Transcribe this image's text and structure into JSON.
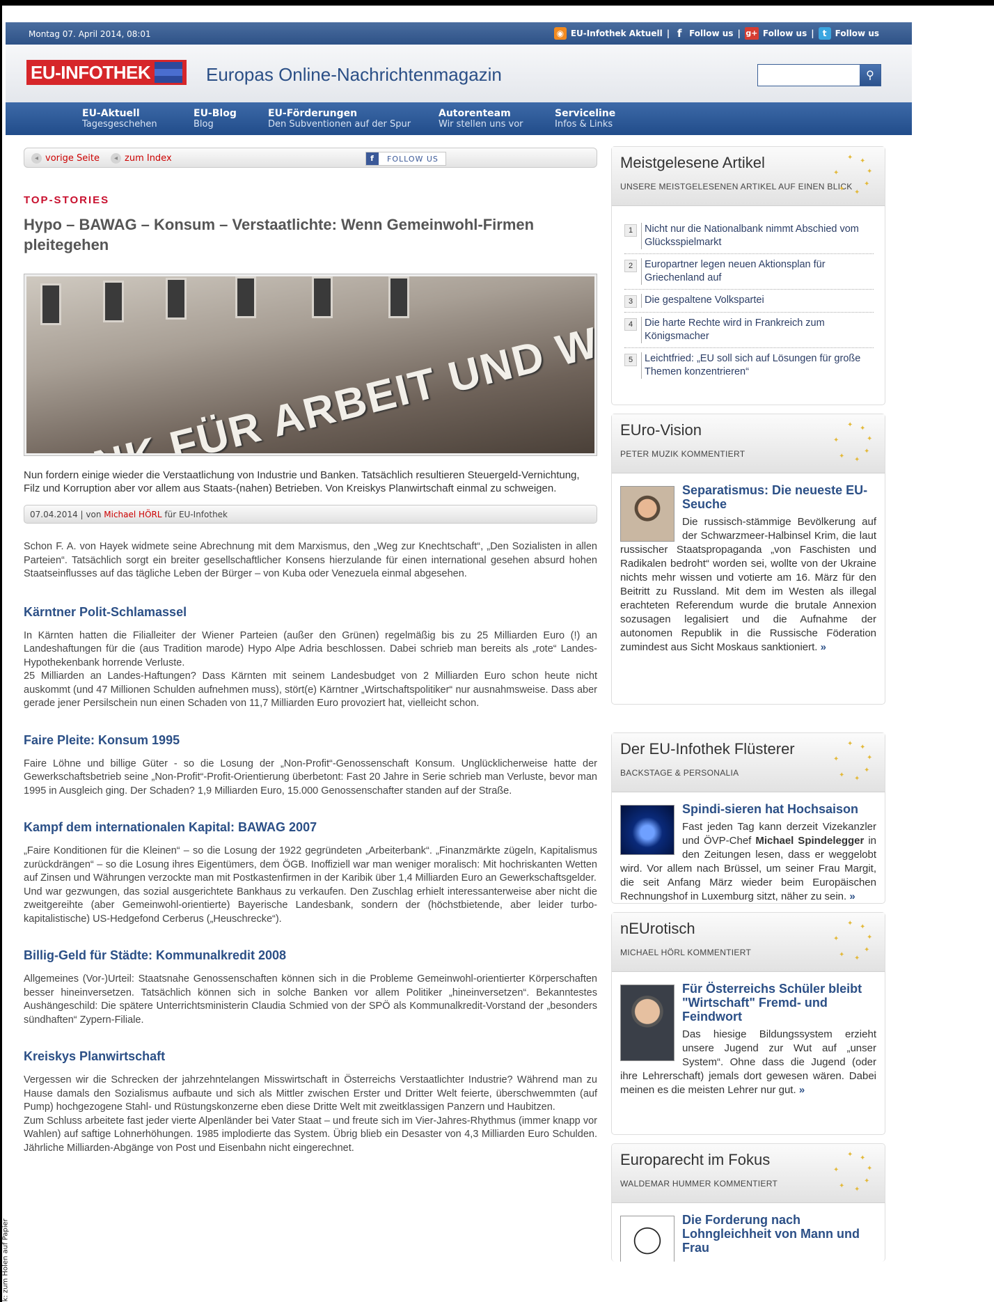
{
  "edge_text": "… grafik: zum Holen auf Papier",
  "topbar": {
    "date": "Montag 07. April 2014, 08:01",
    "aktuell": "EU-Infothek Aktuell",
    "sep": "|",
    "follow1": "Follow us",
    "follow2": "Follow us",
    "follow3": "Follow us"
  },
  "header": {
    "logo": "EU-INFOTHEK",
    "tagline": "Europas Online-Nachrichtenmagazin",
    "search_placeholder": ""
  },
  "nav": [
    {
      "title": "EU-Aktuell",
      "sub": "Tagesgeschehen"
    },
    {
      "title": "EU-Blog",
      "sub": "Blog"
    },
    {
      "title": "EU-Förderungen",
      "sub": "Den Subventionen auf der Spur"
    },
    {
      "title": "Autorenteam",
      "sub": "Wir stellen uns vor"
    },
    {
      "title": "Serviceline",
      "sub": "Infos & Links"
    }
  ],
  "crumbs": {
    "prev": "vorige Seite",
    "index": "zum Index",
    "follow": "FOLLOW US"
  },
  "article": {
    "section": "TOP-STORIES",
    "title": "Hypo – BAWAG – Konsum – Verstaatlichte: Wenn Gemeinwohl-Firmen pleitegehen",
    "image_text": "BANK FÜR ARBEIT UND WIRTSCHAF",
    "lead": "Nun fordern einige wieder die Verstaatlichung von Industrie und Banken. Tatsächlich resultieren Steuergeld-Vernichtung, Filz und Korruption aber vor allem aus Staats-(nahen) Betrieben. Von Kreiskys Planwirtschaft einmal zu schweigen.",
    "meta_date": "07.04.2014 | von",
    "meta_author": "Michael HÖRL",
    "meta_suffix": "für EU-Infothek",
    "intro": "Schon F. A. von Hayek widmete seine Abrechnung mit  dem Marxismus, den  „Weg zur Knechtschaft“, „Den Sozialisten in allen Parteien“. Tatsächlich sorgt ein breiter gesellschaftlicher Konsens hierzulande für einen international gesehen absurd hohen Staatseinflusses auf das tägliche Leben der Bürger – von Kuba oder Venezuela einmal abgesehen.",
    "sections": [
      {
        "heading": "Kärntner Polit-Schlamassel",
        "p1": "In Kärnten hatten die Filialleiter der Wiener Parteien (außer den Grünen) regelmäßig bis zu 25 Milliarden Euro (!) an Landeshaftungen für die (aus Tradition marode) Hypo Alpe Adria beschlossen. Dabei schrieb man bereits als „rote“ Landes-Hypothekenbank horrende Verluste.",
        "p2": "25 Milliarden an Landes-Haftungen? Dass Kärnten mit seinem Landesbudget von 2 Milliarden Euro schon heute nicht auskommt (und 47 Millionen Schulden aufnehmen muss), stört(e)   Kärntner „Wirtschaftspolitiker“ nur ausnahmsweise. Dass aber gerade jener Persilschein nun einen Schaden von 11,7 Milliarden Euro provoziert hat, vielleicht schon."
      },
      {
        "heading": "Faire Pleite: Konsum 1995",
        "p1": "Faire Löhne und billige Güter - so die Losung der „Non-Profit“-Genossenschaft Konsum. Unglücklicherweise hatte der Gewerkschaftsbetrieb seine „Non-Profit“-Profit-Orientierung überbetont: Fast 20 Jahre in Serie schrieb man Verluste, bevor man 1995 in Ausgleich ging. Der Schaden? 1,9 Milliarden Euro, 15.000 Genossenschafter standen auf der Straße.",
        "p2": ""
      },
      {
        "heading": "Kampf dem internationalen Kapital: BAWAG 2007",
        "p1": "„Faire Konditionen für die Kleinen“ – so die Losung der 1922 gegründeten „Arbeiterbank“. „Finanzmärkte zügeln, Kapitalismus zurückdrängen“ – so die Losung ihres Eigentümers, dem ÖGB. Inoffiziell war man weniger moralisch: Mit hochriskanten Wetten auf Zinsen und Währungen verzockte man mit Postkastenfirmen in der Karibik über 1,4 Milliarden Euro an Gewerkschaftsgelder.",
        "p2": "Und war gezwungen, das sozial ausgerichtete Bankhaus zu verkaufen. Den Zuschlag erhielt interessanterweise aber nicht die zweitgereihte (aber Gemeinwohl-orientierte) Bayerische Landesbank, sondern  der (höchstbietende, aber leider turbo-kapitalistische) US-Hedgefond Cerberus („Heuschrecke“)."
      },
      {
        "heading": "Billig-Geld für Städte: Kommunalkredit 2008",
        "p1": "Allgemeines (Vor-)Urteil: Staatsnahe Genossenschaften können sich in die Probleme Gemeinwohl-orientierter Körperschaften besser hineinversetzen. Tatsächlich können sich in solche Banken vor allem Politiker „hineinversetzen“. Bekanntestes Aushängeschild: Die spätere Unterrichtsministerin Claudia Schmied von der SPÖ als Kommunalkredit-Vorstand der „besonders sündhaften“ Zypern-Filiale.",
        "p2": ""
      },
      {
        "heading": "Kreiskys Planwirtschaft",
        "p1": "Vergessen wir die Schrecken der jahrzehntelangen Misswirtschaft  in Österreichs Verstaatlichter Industrie? Während man zu Hause damals den Sozialismus aufbaute und sich als Mittler zwischen Erster und Dritter Welt feierte, überschwemmten (auf Pump) hochgezogene Stahl- und Rüstungskonzerne eben diese Dritte Welt mit zweitklassigen Panzern und Haubitzen.",
        "p2": "Zum Schluss arbeitete fast jeder vierte Alpenländer bei Vater Staat – und freute sich im Vier-Jahres-Rhythmus (immer knapp vor Wahlen) auf saftige Lohnerhöhungen. 1985 implodierte das System. Übrig blieb ein Desaster von 4,3 Milliarden Euro Schulden. Jährliche Milliarden-Abgänge von Post und Eisenbahn nicht eingerechnet."
      }
    ]
  },
  "sidebar": {
    "most_read": {
      "title": "Meistgelesene Artikel",
      "subtitle": "UNSERE MEISTGELESENEN ARTIKEL AUF EINEN BLICK",
      "items": [
        {
          "num": "1",
          "text": "Nicht nur die Nationalbank nimmt Abschied vom Glücksspielmarkt"
        },
        {
          "num": "2",
          "text": "Europartner legen neuen Aktionsplan für Griechenland auf"
        },
        {
          "num": "3",
          "text": "Die gespaltene Volkspartei"
        },
        {
          "num": "4",
          "text": "Die harte Rechte wird in Frankreich zum Königsmacher"
        },
        {
          "num": "5",
          "text": "Leichtfried: „EU soll sich auf Lösungen für große Themen konzentrieren“"
        }
      ]
    },
    "boxes": [
      {
        "title": "EUro-Vision",
        "subtitle": "PETER MUZIK KOMMENTIERT",
        "ftitle": "Separatismus: Die neueste EU-Seuche",
        "text_a": "Die russisch-stämmige Bevölkerung auf der Schwarzmeer-Halbinsel Krim, die laut russischer Staatspropaganda „von Faschisten und Radikalen bedroht“ worden sei, wollte von der Ukraine nichts mehr wissen und votierte am 16. März für den Beitritt zu Russland. Mit dem im Westen als illegal erachteten Referendum wurde die brutale Annexion sozusagen legalisiert und die Aufnahme der autonomen Republik in die Russische Föderation zumindest aus Sicht Moskaus sanktioniert.",
        "bold": "",
        "text_b": "",
        "more": "»"
      },
      {
        "title": "Der EU-Infothek Flüsterer",
        "subtitle": "BACKSTAGE & PERSONALIA",
        "ftitle": "Spindi-sieren hat Hochsaison",
        "text_a": "Fast jeden Tag kann derzeit Vizekanzler und ÖVP-Chef",
        "bold": "Michael Spindelegger",
        "text_b": "in den Zeitungen lesen, dass er weggelobt wird. Vor allem nach Brüssel, um seiner Frau Margit, die seit Anfang März wieder beim Europäischen Rechnungshof in Luxemburg sitzt, näher zu sein.",
        "more": "»"
      },
      {
        "title": "nEUrotisch",
        "subtitle": "MICHAEL HÖRL KOMMENTIERT",
        "ftitle": "Für Österreichs Schüler bleibt \"Wirtschaft\" Fremd- und Feindwort",
        "text_a": "Das hiesige Bildungssystem erzieht unsere Jugend zur Wut auf „unser System“. Ohne dass die Jugend (oder ihre Lehrerschaft) jemals dort gewesen wären. Dabei meinen es die meisten Lehrer nur gut.",
        "bold": "",
        "text_b": "",
        "more": "»"
      },
      {
        "title": "Europarecht im Fokus",
        "subtitle": "WALDEMAR HUMMER KOMMENTIERT",
        "ftitle": "Die Forderung nach Lohngleichheit von Mann und Frau",
        "text_a": "",
        "bold": "",
        "text_b": "",
        "more": ""
      }
    ]
  }
}
